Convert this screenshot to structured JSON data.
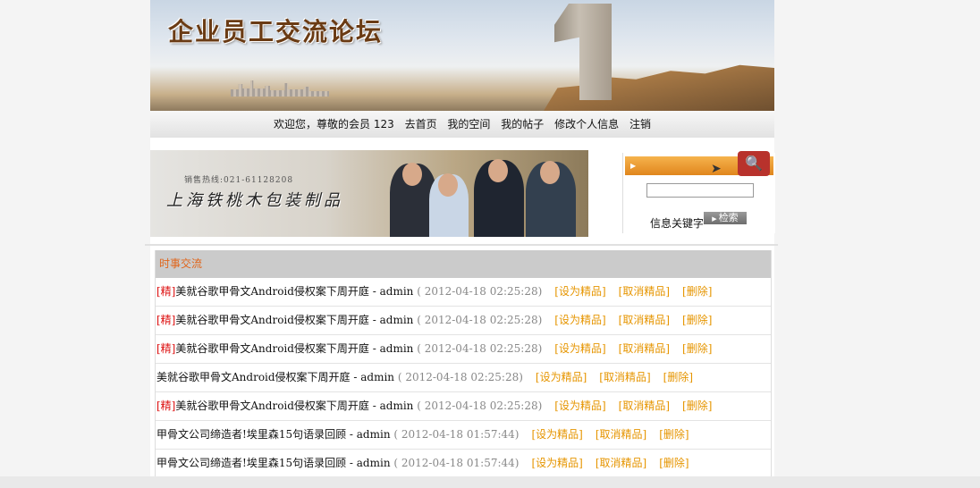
{
  "banner": {
    "title": "企业员工交流论坛"
  },
  "nav": {
    "welcome": "欢迎您，尊敬的会员 123",
    "home": "去首页",
    "my_space": "我的空间",
    "my_posts": "我的帖子",
    "edit_profile": "修改个人信息",
    "logout": "注销"
  },
  "ad": {
    "hotline": "销售热线:021-61128208",
    "slogan": "上海铁桃木包装制品"
  },
  "search": {
    "input_value": "",
    "keyword_label": "信息关键字",
    "button_label": "检索"
  },
  "board": {
    "header": "时事交流",
    "action_labels": {
      "set": "[设为精品]",
      "cancel": "[取消精品]",
      "delete": "[删除]"
    },
    "posts": [
      {
        "tag": "[精]",
        "title": "美就谷歌甲骨文Android侵权案下周开庭",
        "author": " - admin",
        "time": " ( 2012-04-18 02:25:28)"
      },
      {
        "tag": "[精]",
        "title": "美就谷歌甲骨文Android侵权案下周开庭",
        "author": " - admin",
        "time": " ( 2012-04-18 02:25:28)"
      },
      {
        "tag": "[精]",
        "title": "美就谷歌甲骨文Android侵权案下周开庭",
        "author": " - admin",
        "time": " ( 2012-04-18 02:25:28)"
      },
      {
        "tag": "",
        "title": "美就谷歌甲骨文Android侵权案下周开庭",
        "author": " - admin",
        "time": " ( 2012-04-18 02:25:28)"
      },
      {
        "tag": "[精]",
        "title": "美就谷歌甲骨文Android侵权案下周开庭",
        "author": " - admin",
        "time": " ( 2012-04-18 02:25:28)"
      },
      {
        "tag": "",
        "title": "甲骨文公司缔造者!埃里森15句语录回顾",
        "author": " - admin",
        "time": " ( 2012-04-18 01:57:44)"
      },
      {
        "tag": "",
        "title": "甲骨文公司缔造者!埃里森15句语录回顾",
        "author": " - admin",
        "time": " ( 2012-04-18 01:57:44)"
      }
    ]
  },
  "colors": {
    "accent_orange": "#e0861d",
    "tag_red": "#dd1111",
    "action_orange": "#e69500",
    "header_gray": "#cbcbcb"
  }
}
